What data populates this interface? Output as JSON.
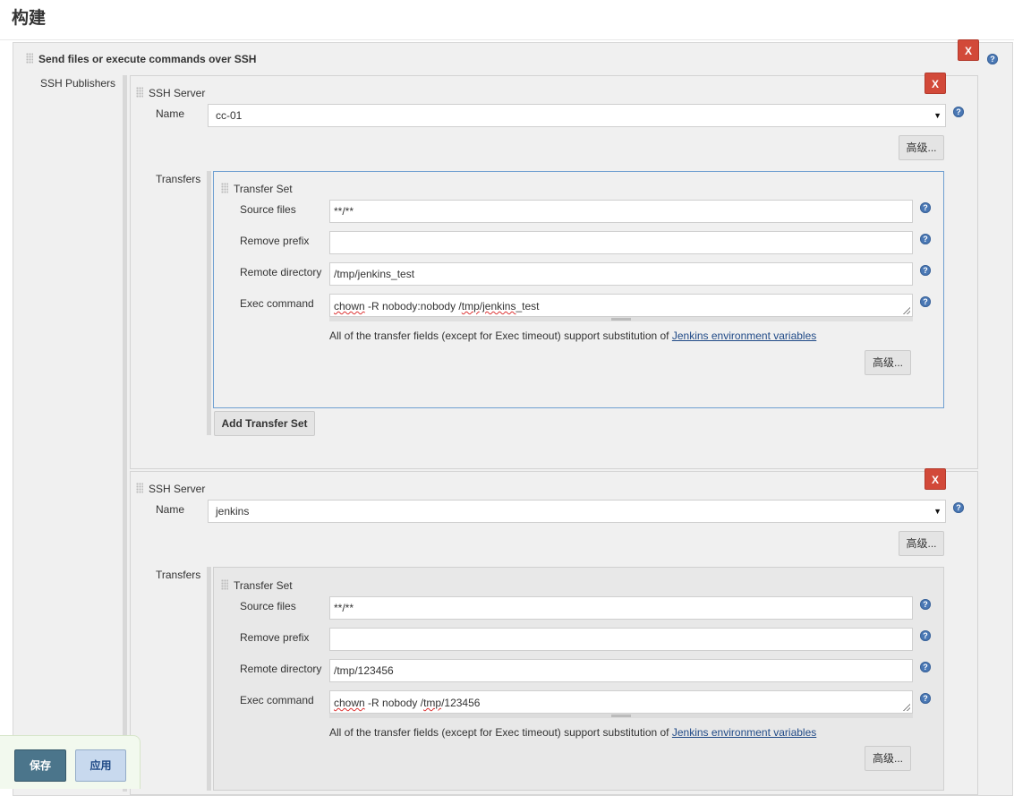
{
  "page_title": "构建",
  "step": {
    "title": "Send files or execute commands over SSH",
    "delete_label": "X",
    "help_icon": "?",
    "publishers_label": "SSH Publishers"
  },
  "servers": [
    {
      "title": "SSH Server",
      "delete_label": "X",
      "name_label": "Name",
      "name_value": "cc-01",
      "advanced_label": "高级...",
      "transfers_label": "Transfers",
      "transfer_set": {
        "title": "Transfer Set",
        "source_files_label": "Source files",
        "source_files_value": "**/**",
        "remove_prefix_label": "Remove prefix",
        "remove_prefix_value": "",
        "remote_directory_label": "Remote directory",
        "remote_directory_value": "/tmp/jenkins_test",
        "exec_command_label": "Exec command",
        "exec_command_value": "chown -R nobody:nobody /tmp/jenkins_test",
        "exec_command_parts": [
          "chown",
          " -R nobody:nobody /",
          "tmp",
          "/",
          "jenkins",
          "_test"
        ],
        "note_text": "All of the transfer fields (except for Exec timeout) support substitution of ",
        "note_link": "Jenkins environment variables",
        "advanced_label": "高级..."
      },
      "add_transfer_label": "Add Transfer Set"
    },
    {
      "title": "SSH Server",
      "delete_label": "X",
      "name_label": "Name",
      "name_value": "jenkins",
      "advanced_label": "高级...",
      "transfers_label": "Transfers",
      "transfer_set": {
        "title": "Transfer Set",
        "source_files_label": "Source files",
        "source_files_value": "**/**",
        "remove_prefix_label": "Remove prefix",
        "remove_prefix_value": "",
        "remote_directory_label": "Remote directory",
        "remote_directory_value": "/tmp/123456",
        "exec_command_label": "Exec command",
        "exec_command_value": "chown -R nobody /tmp/123456",
        "exec_command_parts": [
          "chown",
          " -R nobody /",
          "tmp",
          "/123456"
        ],
        "note_text": "All of the transfer fields (except for Exec timeout) support substitution of ",
        "note_link": "Jenkins environment variables",
        "advanced_label": "高级..."
      }
    }
  ],
  "footer": {
    "save_label": "保存",
    "apply_label": "应用"
  },
  "colors": {
    "delete_red": "#d24939",
    "help_blue": "#4a78b5",
    "save_blue": "#4b758b",
    "link_blue": "#204a87"
  }
}
